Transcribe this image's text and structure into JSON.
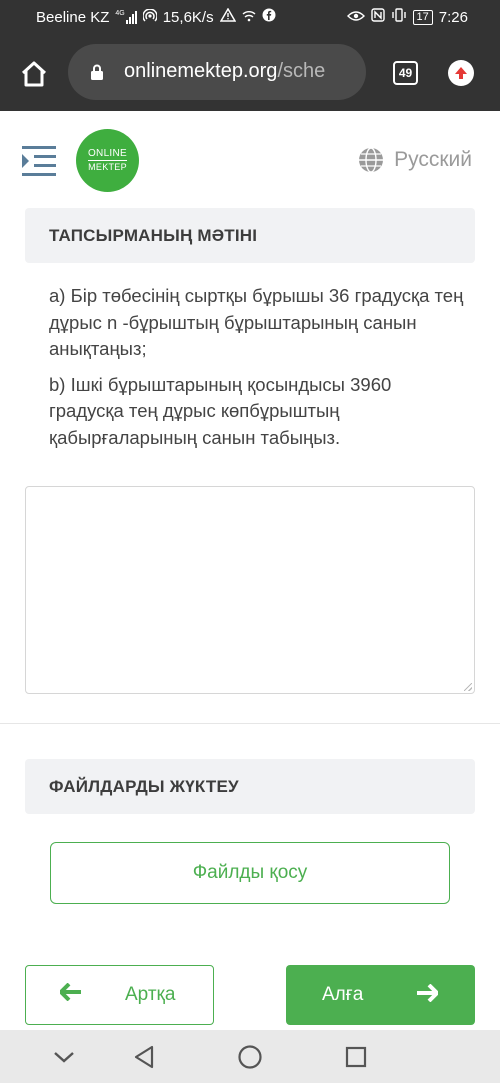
{
  "status_bar": {
    "carrier": "Beeline KZ",
    "network_type": "4G",
    "data_speed": "15,6K/s",
    "battery": "17",
    "time": "7:26"
  },
  "browser": {
    "url_domain": "onlinemektep.org",
    "url_path": "/sche",
    "tab_count": "49"
  },
  "site_header": {
    "logo_line1": "ONLINE",
    "logo_line2": "MEKTEP",
    "language": "Русский"
  },
  "task": {
    "section_title": "ТАПСЫРМАНЫҢ МӘТІНІ",
    "part_a": "a) Бір төбесінің сыртқы бұрышы 36 градусқа тең дұрыс n -бұрыштың бұрыштарының санын анықтаңыз;",
    "part_b": "b) Ішкі бұрыштарының қосындысы 3960 градусқа тең дұрыс көпбұрыштың қабырғаларының санын табыңыз.",
    "answer_value": ""
  },
  "upload": {
    "section_title": "ФАЙЛДАРДЫ ЖҮКТЕУ",
    "add_file_label": "Файлды қосу"
  },
  "navigation": {
    "back_label": "Артқа",
    "next_label": "Алға"
  },
  "colors": {
    "accent": "#4caf50",
    "logo_green": "#3fae3f",
    "chrome_dark": "#333333",
    "section_bg": "#f1f2f4"
  }
}
